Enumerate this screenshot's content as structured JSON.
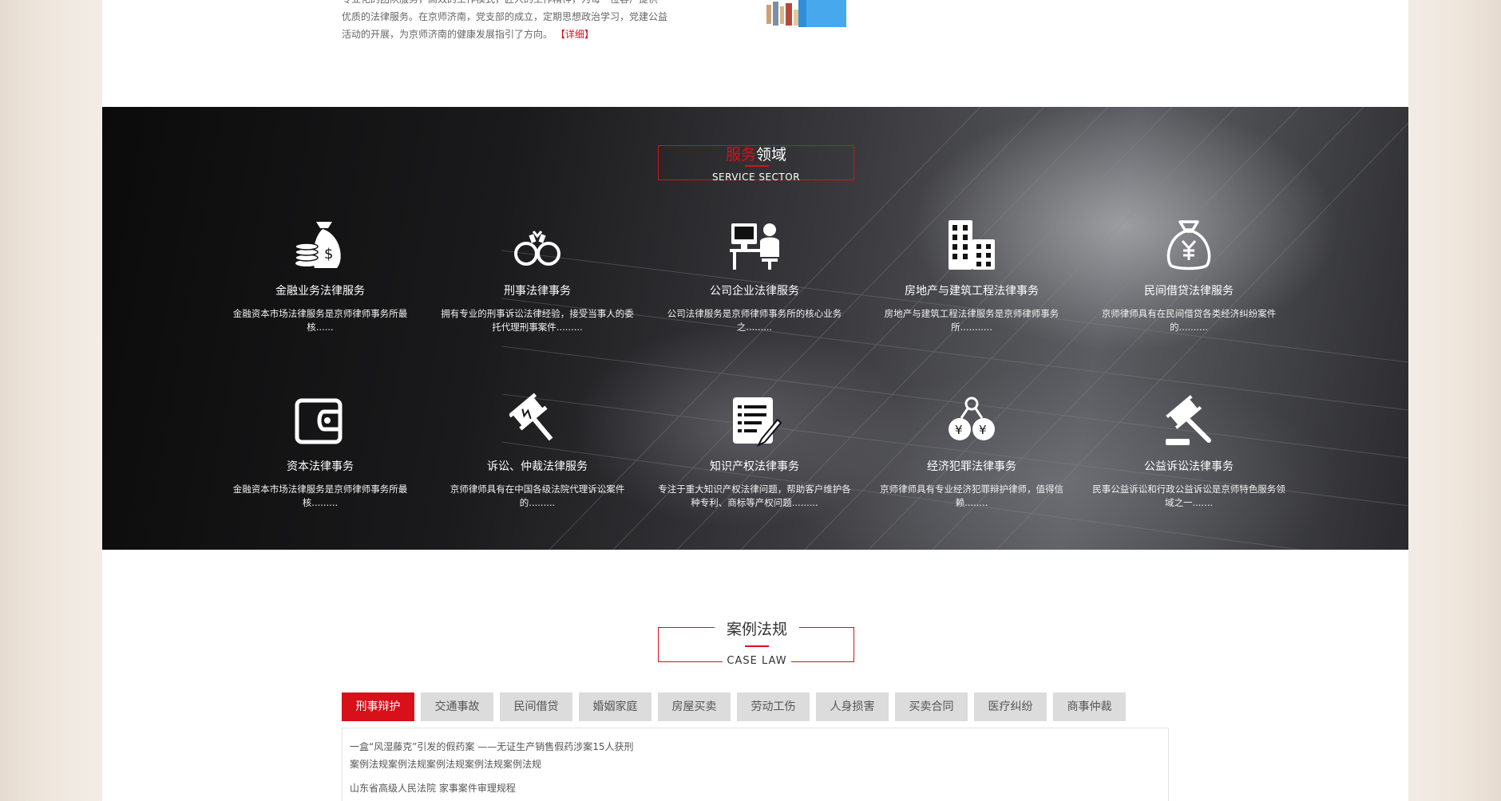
{
  "about": {
    "line1": "专业化的团队服务，高效的工作模式，匠人的工作精神，为每一位客户提供",
    "line2": "优质的法律服务。在京师济南，党支部的成立，定期思想政治学习，党建公益",
    "line3": "活动的开展，为京师济南的健康发展指引了方向。",
    "more_label": "【详细】"
  },
  "service": {
    "title_highlight": "服务",
    "title_rest": "领域",
    "subtitle": "SERVICE SECTOR",
    "items": [
      {
        "name": "金融业务法律服务",
        "desc": "金融资本市场法律服务是京师律师事务所最核......",
        "icon": "money-bag-coins-icon"
      },
      {
        "name": "刑事法律事务",
        "desc": "拥有专业的刑事诉讼法律经验，接受当事人的委托代理刑事案件.........",
        "icon": "handcuffs-icon"
      },
      {
        "name": "公司企业法律服务",
        "desc": "公司法律服务是京师律师事务所的核心业务之.........",
        "icon": "office-worker-icon"
      },
      {
        "name": "房地产与建筑工程法律事务",
        "desc": "房地产与建筑工程法律服务是京师律师事务所...........",
        "icon": "buildings-icon"
      },
      {
        "name": "民间借贷法律服务",
        "desc": "京师律师具有在民间借贷各类经济纠纷案件的..........",
        "icon": "yuan-bag-icon"
      },
      {
        "name": "资本法律事务",
        "desc": "金融资本市场法律服务是京师律师事务所最核.........",
        "icon": "wallet-icon"
      },
      {
        "name": "诉讼、仲裁法律服务",
        "desc": "京师律师具有在中国各级法院代理诉讼案件的.........",
        "icon": "gavel-icon"
      },
      {
        "name": "知识产权法律事务",
        "desc": "专注于重大知识产权法律问题，帮助客户维护各种专利、商标等产权问题.........",
        "icon": "document-pen-icon"
      },
      {
        "name": "经济犯罪法律事务",
        "desc": "京师律师具有专业经济犯罪辩护律师，值得信赖........",
        "icon": "money-handcuffs-icon"
      },
      {
        "name": "公益诉讼法律事务",
        "desc": "民事公益诉讼和行政公益诉讼是京师特色服务领域之一.......",
        "icon": "judge-hammer-icon"
      }
    ]
  },
  "cases": {
    "title": "案例法规",
    "subtitle": "CASE LAW",
    "tabs": [
      "刑事辩护",
      "交通事故",
      "民间借贷",
      "婚姻家庭",
      "房屋买卖",
      "劳动工伤",
      "人身损害",
      "买卖合同",
      "医疗纠纷",
      "商事仲裁"
    ],
    "active_tab": "刑事辩护",
    "items": [
      "一盒“风湿藤克”引发的假药案 ——无证生产销售假药涉案15人获刑",
      "案例法规案例法规案例法规案例法规案例法规",
      "山东省高级人民法院 家事案件审理规程"
    ]
  },
  "colors": {
    "accent": "#d8101a",
    "tab_bg": "#dcdcdc",
    "text": "#555555"
  }
}
